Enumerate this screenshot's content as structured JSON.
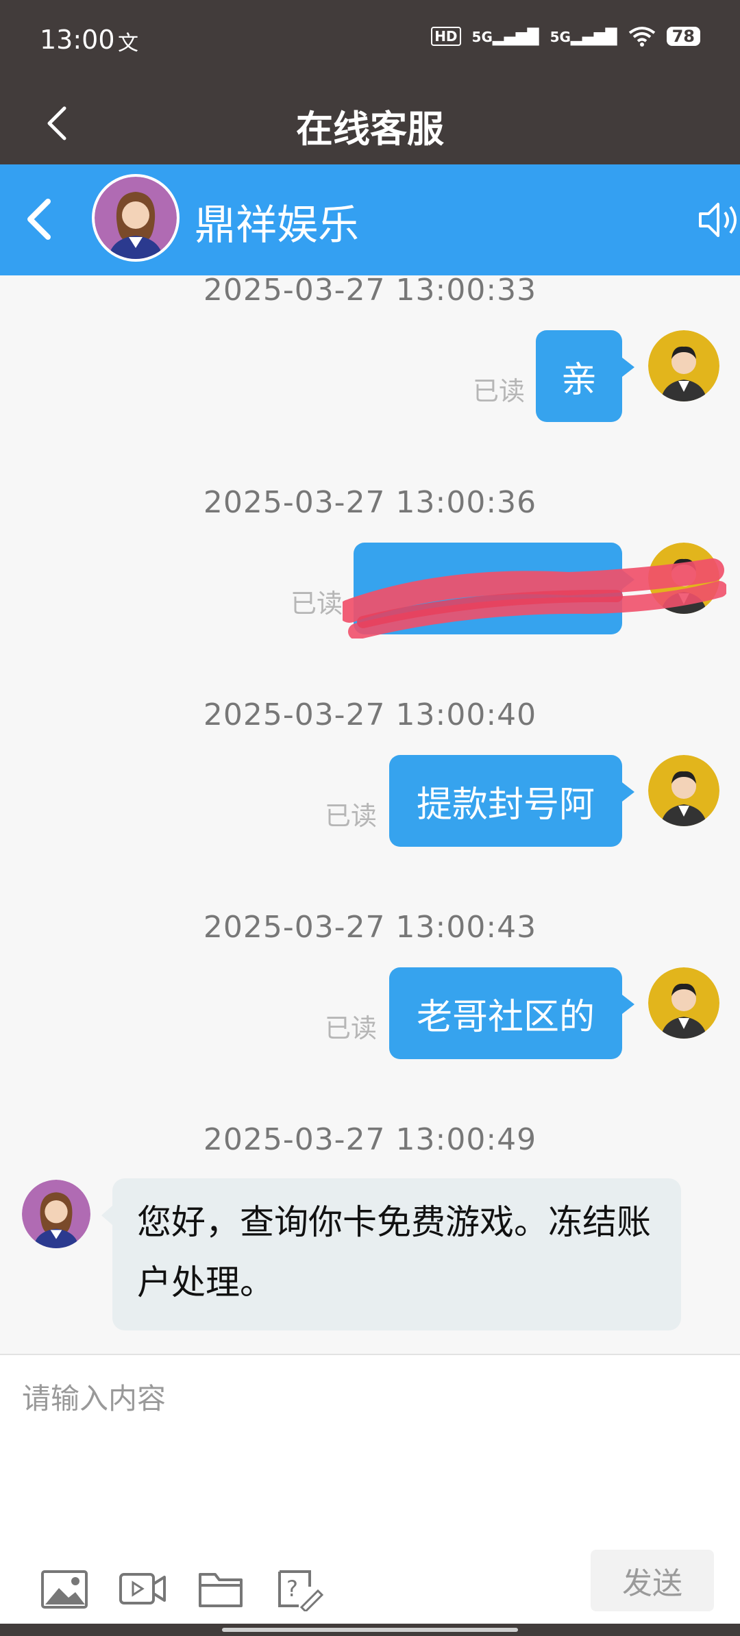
{
  "status_bar": {
    "time": "13:00",
    "extra_icon": "文",
    "network_hd": "HD",
    "network_1": "5G",
    "network_2": "5G",
    "battery": "78"
  },
  "header": {
    "title": "在线客服"
  },
  "chat_header": {
    "contact_name": "鼎祥娱乐"
  },
  "messages": [
    {
      "timestamp": "2025-03-27 13:00:33",
      "direction": "out",
      "text": "亲",
      "status": "已读"
    },
    {
      "timestamp": "2025-03-27 13:00:36",
      "direction": "out",
      "text": "",
      "status": "已读",
      "redacted": true
    },
    {
      "timestamp": "2025-03-27 13:00:40",
      "direction": "out",
      "text": "提款封号阿",
      "status": "已读"
    },
    {
      "timestamp": "2025-03-27 13:00:43",
      "direction": "out",
      "text": "老哥社区的",
      "status": "已读"
    },
    {
      "timestamp": "2025-03-27 13:00:49",
      "direction": "in",
      "text": "您好，查询你卡免费游戏。冻结账户处理。"
    }
  ],
  "input": {
    "placeholder": "请输入内容",
    "send_label": "发送"
  },
  "toolbar": {
    "icons": [
      "image-icon",
      "video-icon",
      "folder-icon",
      "question-edit-icon"
    ]
  },
  "colors": {
    "dark_header": "#423c3b",
    "accent_blue": "#34a0f2",
    "bubble_out": "#36a3ee",
    "bubble_in": "#e8eef0",
    "redaction": "#f0506a"
  }
}
